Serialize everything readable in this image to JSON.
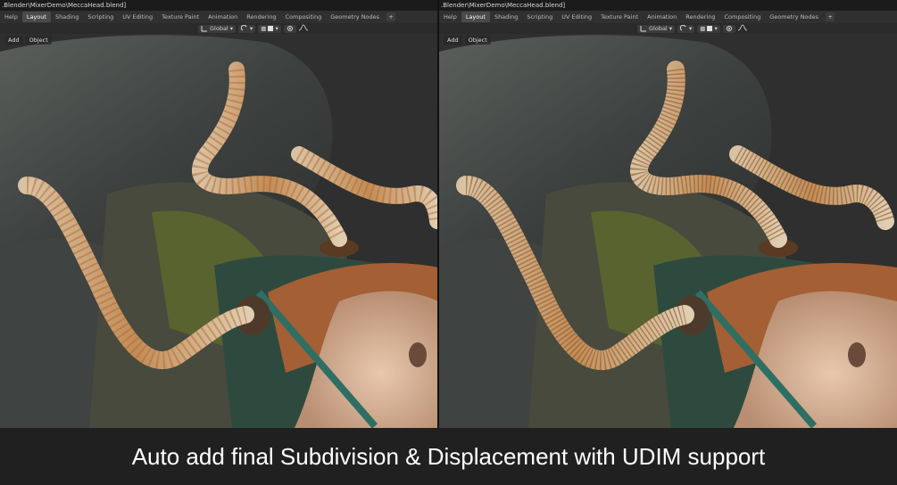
{
  "left": {
    "title_path": ".Blender\\MixerDemo\\MeccaHead.blend]",
    "menu": "Help",
    "tabs": [
      "Layout",
      "Shading",
      "Scripting",
      "UV Editing",
      "Texture Paint",
      "Animation",
      "Rendering",
      "Compositing",
      "Geometry Nodes"
    ],
    "active_tab": "Layout",
    "orientation": "Global",
    "header_buttons": [
      "Add",
      "Object"
    ]
  },
  "right": {
    "title_path": ".Blender\\MixerDemo\\MeccaHead.blend]",
    "menu": "Help",
    "tabs": [
      "Layout",
      "Shading",
      "Scripting",
      "UV Editing",
      "Texture Paint",
      "Animation",
      "Rendering",
      "Compositing",
      "Geometry Nodes"
    ],
    "active_tab": "Layout",
    "orientation": "Global",
    "header_buttons": [
      "Add",
      "Object"
    ]
  },
  "caption": "Auto add final Subdivision & Displacement with UDIM support",
  "icons": {
    "add_tab": "plus-icon",
    "transform_orientation": "orientation-icon",
    "snap": "snap-icon",
    "proportional": "proportional-edit-icon",
    "falloff": "falloff-curve-icon"
  },
  "colors": {
    "ui_bg": "#303030",
    "active_tab": "#4a4a4a",
    "rock": "#4d5150",
    "moss": "#6b7a2a",
    "tentacle": "#c9a27a",
    "rust": "#b8682a",
    "leather": "#b06a3a",
    "teal_trim": "#2f6f63",
    "skin": "#d9b49a",
    "caption_bg": "#202020",
    "caption_text": "#ffffff"
  }
}
